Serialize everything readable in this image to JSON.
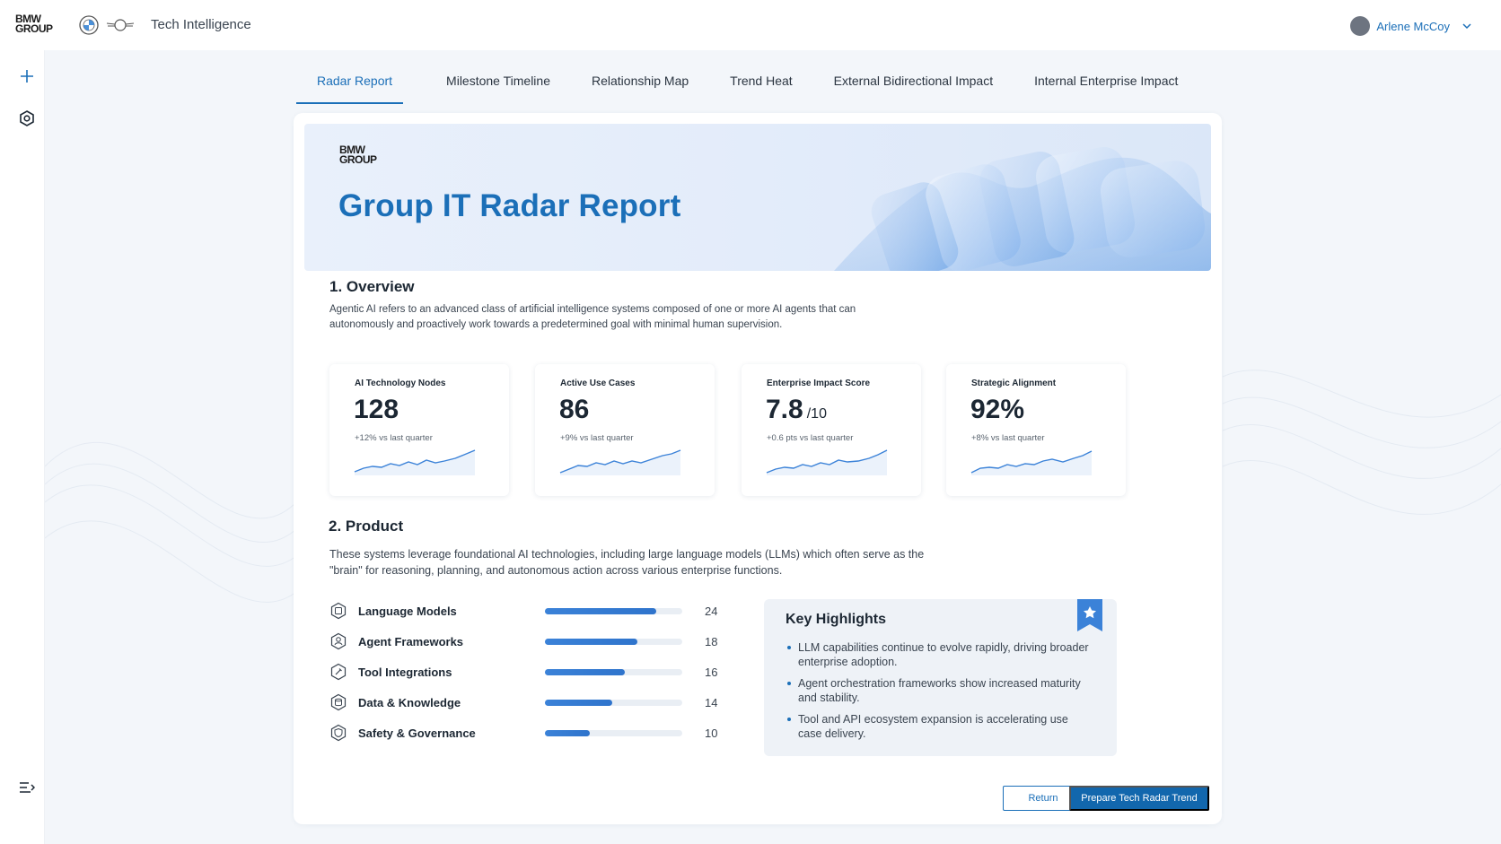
{
  "header": {
    "brand_logo": "BMW GROUP",
    "app_title": "Tech Intelligence",
    "user_name": "Arlene McCoy"
  },
  "tabs": [
    {
      "label": "Radar Report",
      "active": true
    },
    {
      "label": "Milestone Timeline",
      "active": false
    },
    {
      "label": "Relationship Map",
      "active": false
    },
    {
      "label": "Trend Heat",
      "active": false
    },
    {
      "label": "External Bidirectional Impact",
      "active": false
    },
    {
      "label": "Internal Enterprise Impact",
      "active": false
    }
  ],
  "hero": {
    "logo": "BMW GROUP",
    "title": "Group IT Radar Report"
  },
  "overview": {
    "title": "1. Overview",
    "text_line1": "Agentic AI refers to an advanced class of artificial intelligence systems composed of one or more AI agents that can",
    "text_line2": "autonomously and proactively work towards a predetermined goal with minimal human supervision.",
    "metrics": [
      {
        "label": "AI Technology Nodes",
        "value": "128",
        "unit": "",
        "delta": "+12% vs last quarter"
      },
      {
        "label": "Active Use Cases",
        "value": "86",
        "unit": "",
        "delta": "+9% vs last quarter"
      },
      {
        "label": "Enterprise Impact Score",
        "value": "7.8",
        "unit": "/10",
        "delta": "+0.6 pts vs last quarter"
      },
      {
        "label": "Strategic Alignment",
        "value": "92%",
        "unit": "",
        "delta": "+8% vs last quarter"
      }
    ]
  },
  "product": {
    "title": "2. Product",
    "text_line1": "These systems leverage foundational AI technologies, including large language models (LLMs) which often serve as the",
    "text_line2": "\"brain\" for reasoning, planning, and autonomous action across various enterprise functions.",
    "items": [
      {
        "label": "Language Models",
        "count": "24",
        "fill": 0.81
      },
      {
        "label": "Agent Frameworks",
        "count": "18",
        "fill": 0.67
      },
      {
        "label": "Tool Integrations",
        "count": "16",
        "fill": 0.58
      },
      {
        "label": "Data & Knowledge",
        "count": "14",
        "fill": 0.49
      },
      {
        "label": "Safety & Governance",
        "count": "10",
        "fill": 0.33
      }
    ]
  },
  "highlights": {
    "title": "Key Highlights",
    "items": [
      "LLM capabilities continue to evolve rapidly, driving broader enterprise adoption.",
      "Agent orchestration frameworks show increased maturity and stability.",
      "Tool and API ecosystem expansion is accelerating use case delivery."
    ]
  },
  "actions": {
    "return_label": "Return",
    "primary_label": "Prepare Tech Radar Trend"
  },
  "colors": {
    "accent": "#1b6fb8",
    "primary_button": "#1267ad"
  }
}
